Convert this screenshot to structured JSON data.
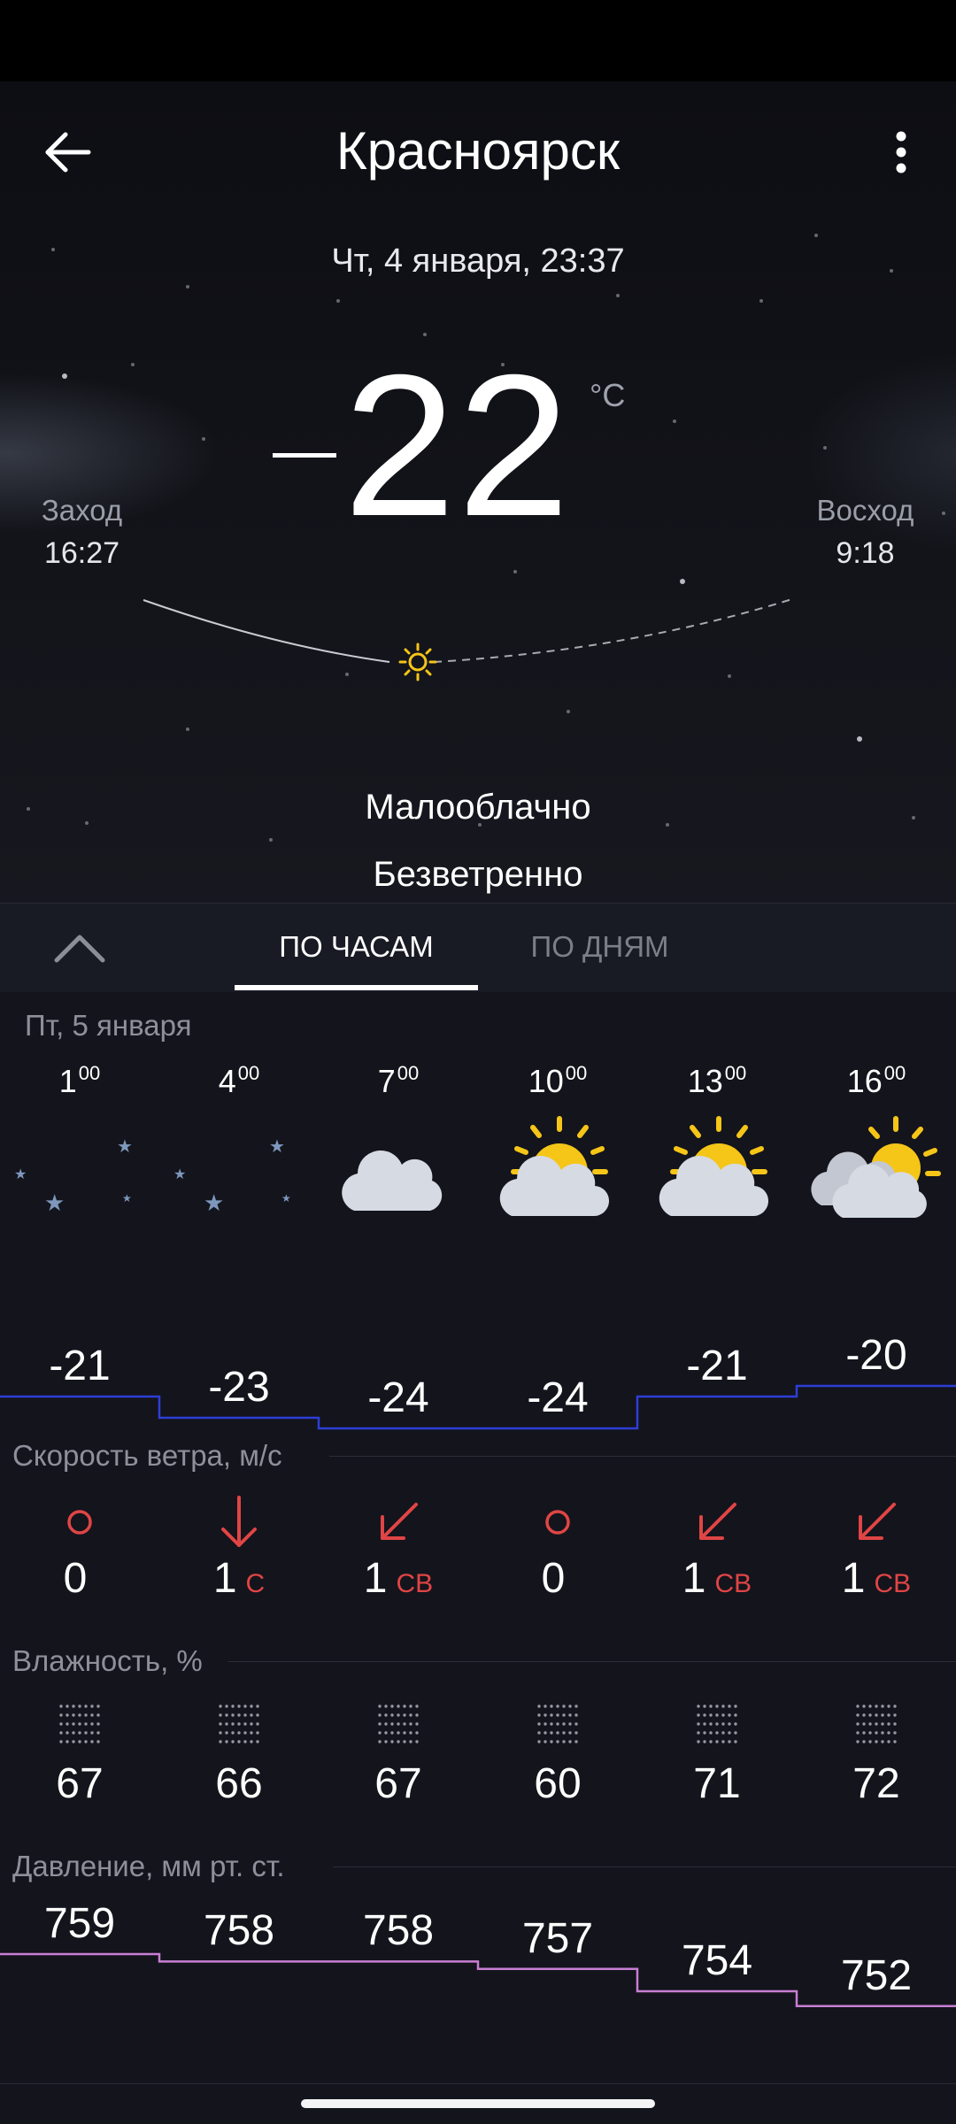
{
  "header": {
    "city": "Красноярск",
    "datetime": "Чт, 4 января, 23:37"
  },
  "current": {
    "temperature": "22",
    "unit": "°C",
    "condition": "Малооблачно",
    "wind": "Безветренно"
  },
  "sun": {
    "sunset_label": "Заход",
    "sunset_time": "16:27",
    "sunrise_label": "Восход",
    "sunrise_time": "9:18"
  },
  "tabs": [
    {
      "label": "ПО ЧАСАМ",
      "active": true
    },
    {
      "label": "ПО ДНЯМ",
      "active": false
    }
  ],
  "hourly": {
    "day_label": "Пт, 5 января",
    "hours": [
      {
        "hour": "1",
        "minutes": "00",
        "icon": "moon-stars-icon",
        "temp": "-21",
        "wind_speed": "0",
        "wind_dir": "",
        "wind_icon": "calm-circle-icon",
        "humidity": "67",
        "pressure": "759"
      },
      {
        "hour": "4",
        "minutes": "00",
        "icon": "moon-stars-icon",
        "temp": "-23",
        "wind_speed": "1",
        "wind_dir": "С",
        "wind_icon": "arrow-down-icon",
        "humidity": "66",
        "pressure": "758"
      },
      {
        "hour": "7",
        "minutes": "00",
        "icon": "moon-cloud-icon",
        "temp": "-24",
        "wind_speed": "1",
        "wind_dir": "СВ",
        "wind_icon": "arrow-down-left-icon",
        "humidity": "67",
        "pressure": "758"
      },
      {
        "hour": "10",
        "minutes": "00",
        "icon": "sun-cloud-icon",
        "temp": "-24",
        "wind_speed": "0",
        "wind_dir": "",
        "wind_icon": "calm-circle-icon",
        "humidity": "60",
        "pressure": "757"
      },
      {
        "hour": "13",
        "minutes": "00",
        "icon": "sun-cloud-icon",
        "temp": "-21",
        "wind_speed": "1",
        "wind_dir": "СВ",
        "wind_icon": "arrow-down-left-icon",
        "humidity": "71",
        "pressure": "754"
      },
      {
        "hour": "16",
        "minutes": "00",
        "icon": "sun-clouds-icon",
        "temp": "-20",
        "wind_speed": "1",
        "wind_dir": "СВ",
        "wind_icon": "arrow-down-left-icon",
        "humidity": "72",
        "pressure": "752"
      }
    ]
  },
  "sections": {
    "wind_title": "Скорость ветра, м/с",
    "humidity_title": "Влажность, %",
    "pressure_title": "Давление, мм рт. ст."
  },
  "colors": {
    "temp_line": "#2d3fd6",
    "pressure_line": "#c77fd3",
    "wind_accent": "#e04545",
    "sun_accent": "#f5c518"
  }
}
